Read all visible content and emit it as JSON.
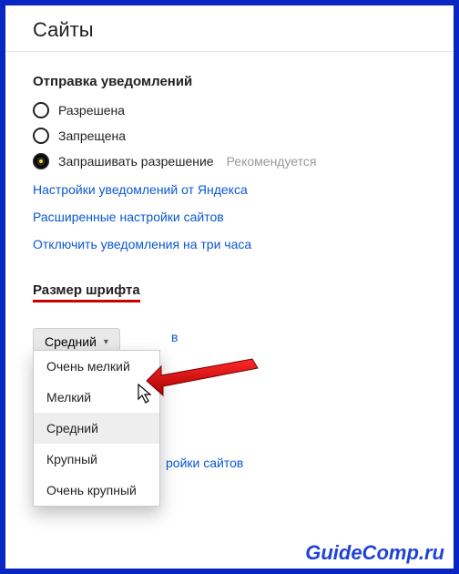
{
  "title": "Сайты",
  "notifications": {
    "heading": "Отправка уведомлений",
    "options": [
      {
        "label": "Разрешена",
        "selected": false
      },
      {
        "label": "Запрещена",
        "selected": false
      },
      {
        "label": "Запрашивать разрешение",
        "selected": true,
        "hint": "Рекомендуется"
      }
    ],
    "links": [
      "Настройки уведомлений от Яндекса",
      "Расширенные настройки сайтов",
      "Отключить уведомления на три часа"
    ]
  },
  "font_size": {
    "heading": "Размер шрифта",
    "selected": "Средний",
    "options": [
      "Очень мелкий",
      "Мелкий",
      "Средний",
      "Крупный",
      "Очень крупный"
    ]
  },
  "peek_text": {
    "behind1": "в",
    "behind2": "ройки сайтов"
  },
  "watermark": "GuideComp.ru"
}
